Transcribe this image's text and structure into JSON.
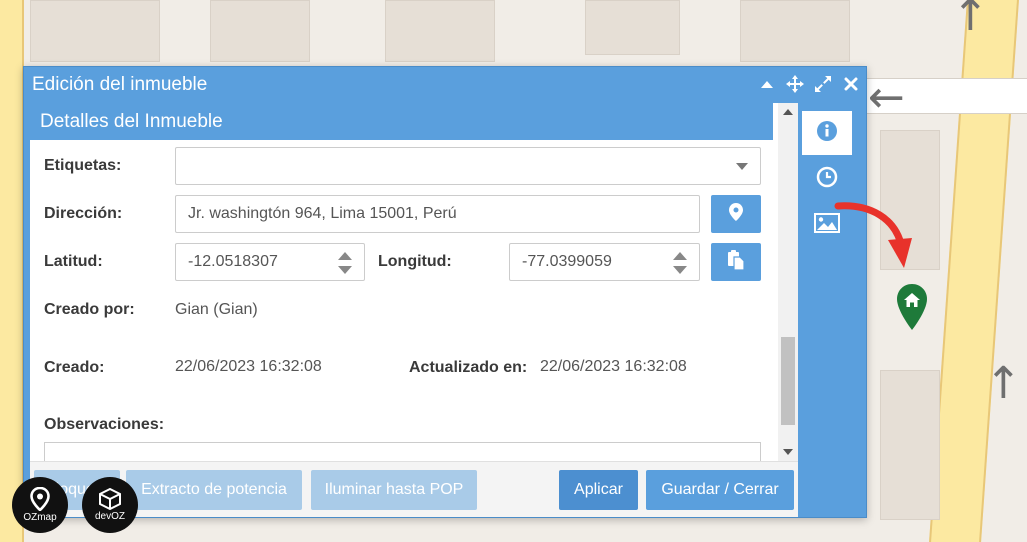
{
  "dialog": {
    "title": "Edición del inmueble",
    "section_title": "Detalles del Inmueble"
  },
  "form": {
    "etiquetas_label": "Etiquetas:",
    "etiquetas_value": "",
    "direccion_label": "Dirección:",
    "direccion_value": "Jr. washingtón 964, Lima 15001, Perú",
    "latitud_label": "Latitud:",
    "latitud_value": "-12.0518307",
    "longitud_label": "Longitud:",
    "longitud_value": "-77.0399059",
    "creado_por_label": "Creado por:",
    "creado_por_value": "Gian (Gian)",
    "creado_label": "Creado:",
    "creado_value": "22/06/2023 16:32:08",
    "actualizado_label": "Actualizado en:",
    "actualizado_value": "22/06/2023 16:32:08",
    "observaciones_label": "Observaciones:"
  },
  "footer": {
    "btn1_label": "Bloquear",
    "btn2_label": "Extracto de potencia",
    "btn3_label": "Iluminar hasta POP",
    "apply_label": "Aplicar",
    "save_label": "Guardar / Cerrar"
  },
  "side_tabs": [
    {
      "icon": "info-icon",
      "active": true
    },
    {
      "icon": "clock-icon",
      "active": false
    },
    {
      "icon": "image-icon",
      "active": false
    }
  ],
  "logos": {
    "ozmap_text": "OZmap",
    "devoz_text": "devOZ"
  },
  "colors": {
    "dialog_blue": "#5a9fdd",
    "disabled_blue": "#a9cbe8",
    "pin_green": "#1e7a3a",
    "arrow_red": "#e8322b"
  }
}
